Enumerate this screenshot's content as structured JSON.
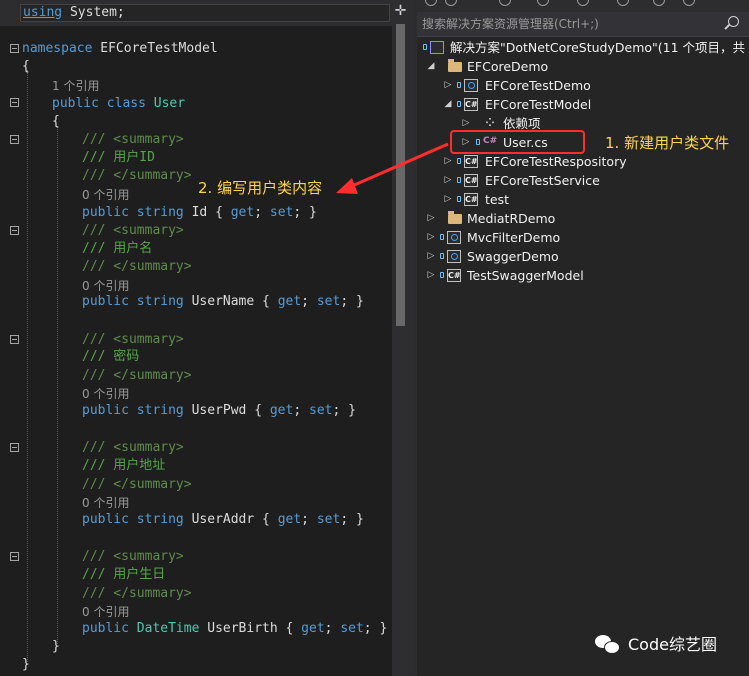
{
  "editor": {
    "nav_dropdown": {
      "keyword": "using",
      "rest": " System;"
    },
    "lines": {
      "namespace_kw": "namespace",
      "namespace_name": " EFCoreTestModel",
      "brace_open": "{",
      "brace_close": "}",
      "class_refs": "1 个引用",
      "class_public": "public",
      "class_kw": " class ",
      "class_name": "User",
      "summary_open": "/// <summary>",
      "summary_close": "/// </summary>",
      "zero_refs": "0 个引用",
      "public_kw": "public",
      "string_kw": "string",
      "get_kw": "get",
      "set_kw": "set",
      "datetime_ty": "DateTime"
    },
    "properties": [
      {
        "comment": "/// 用户ID",
        "name": " Id { ",
        "tail": "; }"
      },
      {
        "comment": "/// 用户名",
        "name": " UserName { ",
        "tail": "; }"
      },
      {
        "comment": "/// 密码",
        "name": " UserPwd { ",
        "tail": "; }"
      },
      {
        "comment": "/// 用户地址",
        "name": " UserAddr { ",
        "tail": "; }"
      },
      {
        "comment": "/// 用户生日",
        "name": " UserBirth { ",
        "tail": "; }"
      }
    ]
  },
  "solution_explorer": {
    "search_placeholder": "搜索解决方案资源管理器(Ctrl+;)",
    "solution": "解决方案\"DotNetCoreStudyDemo\"(11 个项目，共 11",
    "nodes": {
      "efcoredemo": "EFCoreDemo",
      "efcoretestdemo": "EFCoreTestDemo",
      "efcoretestmodel": "EFCoreTestModel",
      "dependencies": "依赖项",
      "usercs": "User.cs",
      "respository": "EFCoreTestRespository",
      "service": "EFCoreTestService",
      "test": "test",
      "mediatr": "MediatRDemo",
      "mvcfilter": "MvcFilterDemo",
      "swagger": "SwaggerDemo",
      "testswagger": "TestSwaggerModel"
    }
  },
  "annotations": {
    "step1": "1. 新建用户类文件",
    "step2": "2. 编写用户类内容",
    "color": "#ff2d2d",
    "text_color": "#ffd54a"
  },
  "watermark": {
    "text": "Code综艺圈"
  }
}
